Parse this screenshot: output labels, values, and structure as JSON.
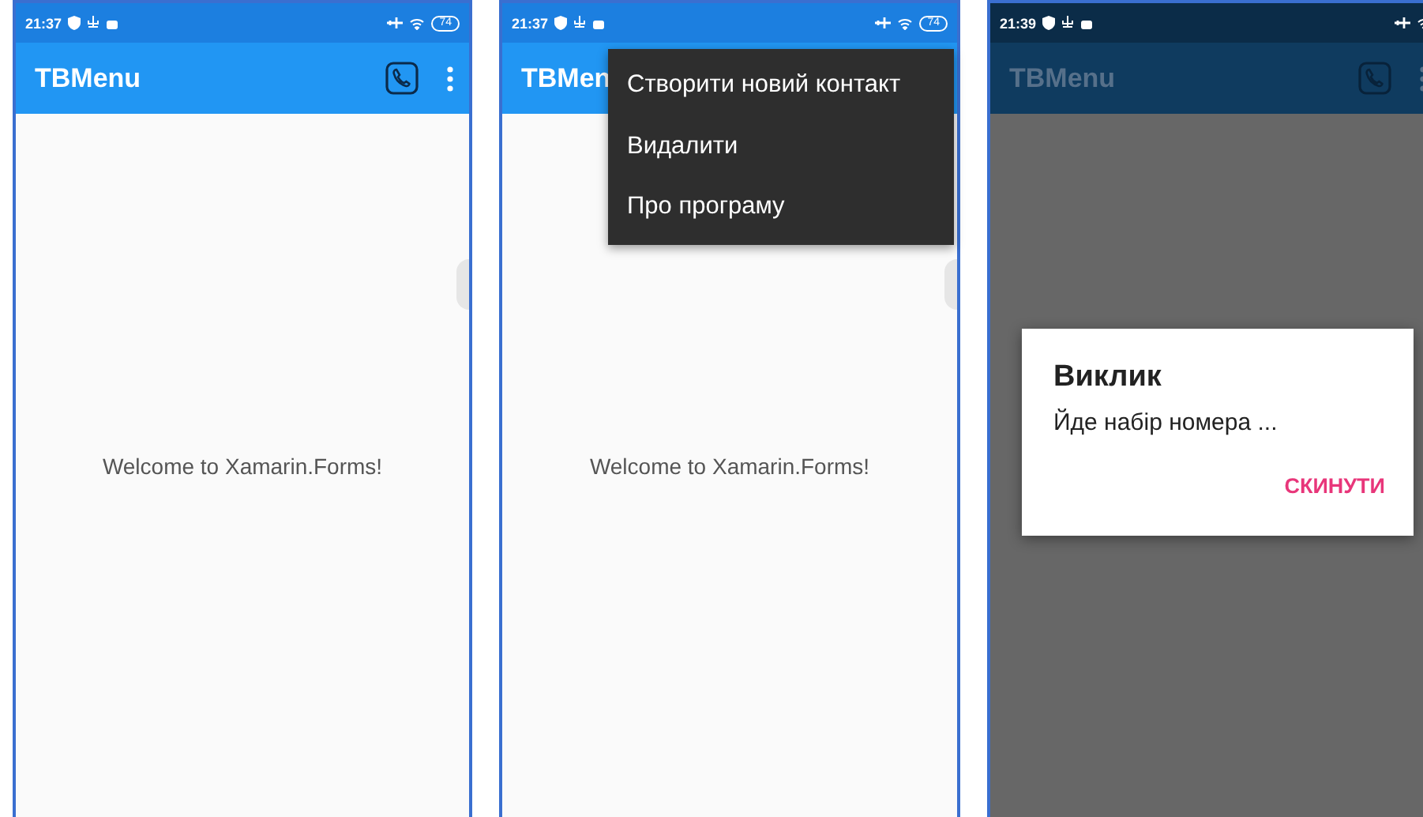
{
  "screens": [
    {
      "status": {
        "time": "21:37",
        "battery": "74"
      },
      "title": "TBMenu",
      "body_text": "Welcome to Xamarin.Forms!",
      "dimmed": false
    },
    {
      "status": {
        "time": "21:37",
        "battery": "74"
      },
      "title": "TBMen",
      "body_text": "Welcome to Xamarin.Forms!",
      "dimmed": false,
      "menu": [
        "Створити новий контакт",
        "Видалити",
        "Про програму"
      ]
    },
    {
      "status": {
        "time": "21:39"
      },
      "title": "TBMenu",
      "dimmed": true,
      "dialog": {
        "title": "Виклик",
        "message": "Йде набір номера ...",
        "button": "СКИНУТИ"
      }
    }
  ]
}
